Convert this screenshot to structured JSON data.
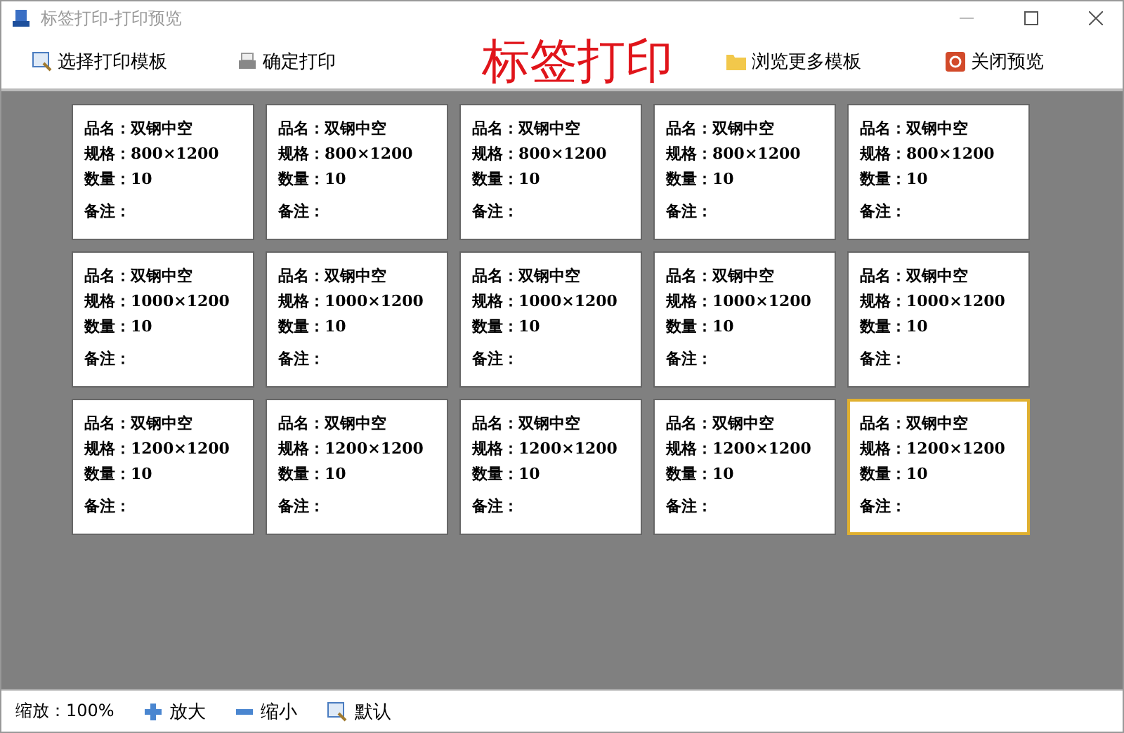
{
  "window": {
    "title": "标签打印-打印预览"
  },
  "toolbar": {
    "items": [
      {
        "label": "选择打印模板",
        "kind": "magnifier"
      },
      {
        "label": "确定打印",
        "kind": "printer"
      }
    ],
    "heading": "标签打印",
    "right_items": [
      {
        "label": "浏览更多模板",
        "kind": "folder"
      },
      {
        "label": "关闭预览",
        "kind": "power"
      }
    ]
  },
  "labels": [
    {
      "lines": [
        "品名：双钢中空",
        "规格：800×1200",
        "数量：10",
        "备注："
      ],
      "selected": false
    },
    {
      "lines": [
        "品名：双钢中空",
        "规格：800×1200",
        "数量：10",
        "备注："
      ],
      "selected": false
    },
    {
      "lines": [
        "品名：双钢中空",
        "规格：800×1200",
        "数量：10",
        "备注："
      ],
      "selected": false
    },
    {
      "lines": [
        "品名：双钢中空",
        "规格：800×1200",
        "数量：10",
        "备注："
      ],
      "selected": false
    },
    {
      "lines": [
        "品名：双钢中空",
        "规格：800×1200",
        "数量：10",
        "备注："
      ],
      "selected": false
    },
    {
      "lines": [
        "品名：双钢中空",
        "规格：1000×1200",
        "数量：10",
        "备注："
      ],
      "selected": false
    },
    {
      "lines": [
        "品名：双钢中空",
        "规格：1000×1200",
        "数量：10",
        "备注："
      ],
      "selected": false
    },
    {
      "lines": [
        "品名：双钢中空",
        "规格：1000×1200",
        "数量：10",
        "备注："
      ],
      "selected": false
    },
    {
      "lines": [
        "品名：双钢中空",
        "规格：1000×1200",
        "数量：10",
        "备注："
      ],
      "selected": false
    },
    {
      "lines": [
        "品名：双钢中空",
        "规格：1000×1200",
        "数量：10",
        "备注："
      ],
      "selected": false
    },
    {
      "lines": [
        "品名：双钢中空",
        "规格：1200×1200",
        "数量：10",
        "备注："
      ],
      "selected": false
    },
    {
      "lines": [
        "品名：双钢中空",
        "规格：1200×1200",
        "数量：10",
        "备注："
      ],
      "selected": false
    },
    {
      "lines": [
        "品名：双钢中空",
        "规格：1200×1200",
        "数量：10",
        "备注："
      ],
      "selected": false
    },
    {
      "lines": [
        "品名：双钢中空",
        "规格：1200×1200",
        "数量：10",
        "备注："
      ],
      "selected": false
    },
    {
      "lines": [
        "品名：双钢中空",
        "规格：1200×1200",
        "数量：10",
        "备注："
      ],
      "selected": true
    }
  ],
  "status_bar": {
    "zoom": "缩放：100%",
    "buttons": [
      {
        "label": "放大",
        "kind": "plus"
      },
      {
        "label": "缩小",
        "kind": "minus"
      },
      {
        "label": "默认",
        "kind": "magnifier"
      }
    ]
  }
}
